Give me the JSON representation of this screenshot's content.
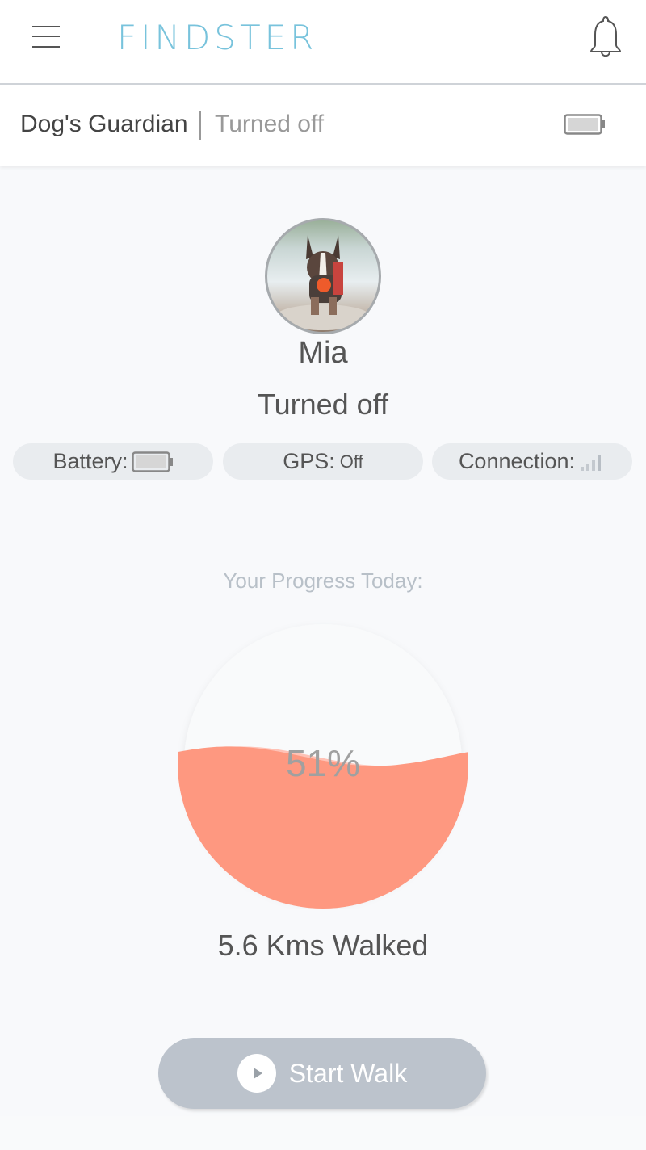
{
  "app": {
    "logo": "FINDSTER",
    "accent_color": "#78c3dc"
  },
  "header": {
    "menu_icon": "hamburger-menu-icon",
    "notification_icon": "bell-icon"
  },
  "device_bar": {
    "title": "Dog's Guardian",
    "status": "Turned off",
    "battery_icon": "battery-icon"
  },
  "pet": {
    "name": "Mia",
    "status": "Turned off",
    "avatar_icon": "dog-photo"
  },
  "status_pills": {
    "battery": {
      "label": "Battery:",
      "icon": "battery-icon"
    },
    "gps": {
      "label": "GPS:",
      "value": "Off"
    },
    "connection": {
      "label": "Connection:",
      "icon": "signal-bars-icon"
    }
  },
  "progress": {
    "label": "Your Progress Today:",
    "percent_text": "51%",
    "fill_fraction": 0.51,
    "fill_color": "#fe9880",
    "wave_color": "#ffc2b6",
    "walked_text": "5.6 Kms Walked"
  },
  "actions": {
    "start_walk_label": "Start Walk",
    "play_icon": "play-icon"
  }
}
